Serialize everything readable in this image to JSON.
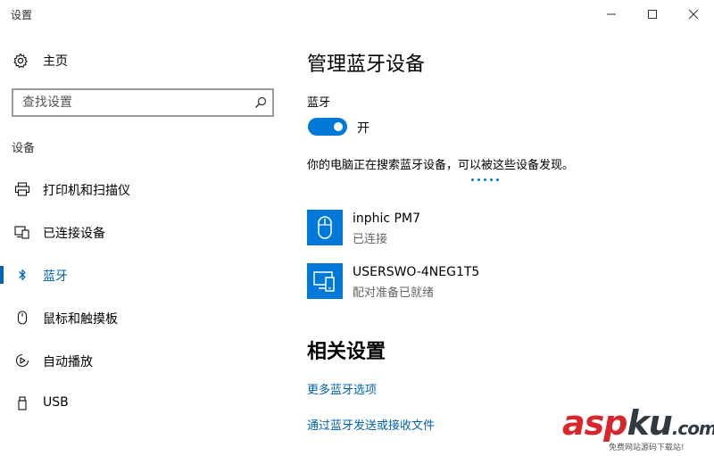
{
  "window": {
    "title": "设置",
    "controls": [
      "minimize-icon",
      "maximize-icon",
      "close-icon"
    ]
  },
  "sidebar": {
    "home_label": "主页",
    "search_placeholder": "查找设置",
    "section_title": "设备",
    "items": [
      {
        "label": "打印机和扫描仪",
        "icon": "printer-icon",
        "active": false
      },
      {
        "label": "已连接设备",
        "icon": "connected-devices-icon",
        "active": false
      },
      {
        "label": "蓝牙",
        "icon": "bluetooth-icon",
        "active": true
      },
      {
        "label": "鼠标和触摸板",
        "icon": "mouse-icon",
        "active": false
      },
      {
        "label": "自动播放",
        "icon": "autoplay-icon",
        "active": false
      },
      {
        "label": "USB",
        "icon": "usb-icon",
        "active": false
      }
    ]
  },
  "main": {
    "heading": "管理蓝牙设备",
    "bluetooth_label": "蓝牙",
    "toggle_state": "开",
    "toggle_on": true,
    "discover_text": "你的电脑正在搜索蓝牙设备，可以被这些设备发现。",
    "devices": [
      {
        "name": "inphic PM7",
        "status": "已连接",
        "icon": "mouse-icon"
      },
      {
        "name": "USERSWO-4NEG1T5",
        "status": "配对准备已就绪",
        "icon": "computer-phone-icon"
      }
    ],
    "related_heading": "相关设置",
    "links": [
      "更多蓝牙选项",
      "通过蓝牙发送或接收文件"
    ]
  },
  "watermark": {
    "text_red": "asp",
    "text_dark": "ku",
    "suffix": ".com",
    "subtitle": "免费网站源码下载站!"
  },
  "colors": {
    "accent": "#0078d7",
    "link": "#0063b1",
    "watermark_red": "#d9262c"
  }
}
